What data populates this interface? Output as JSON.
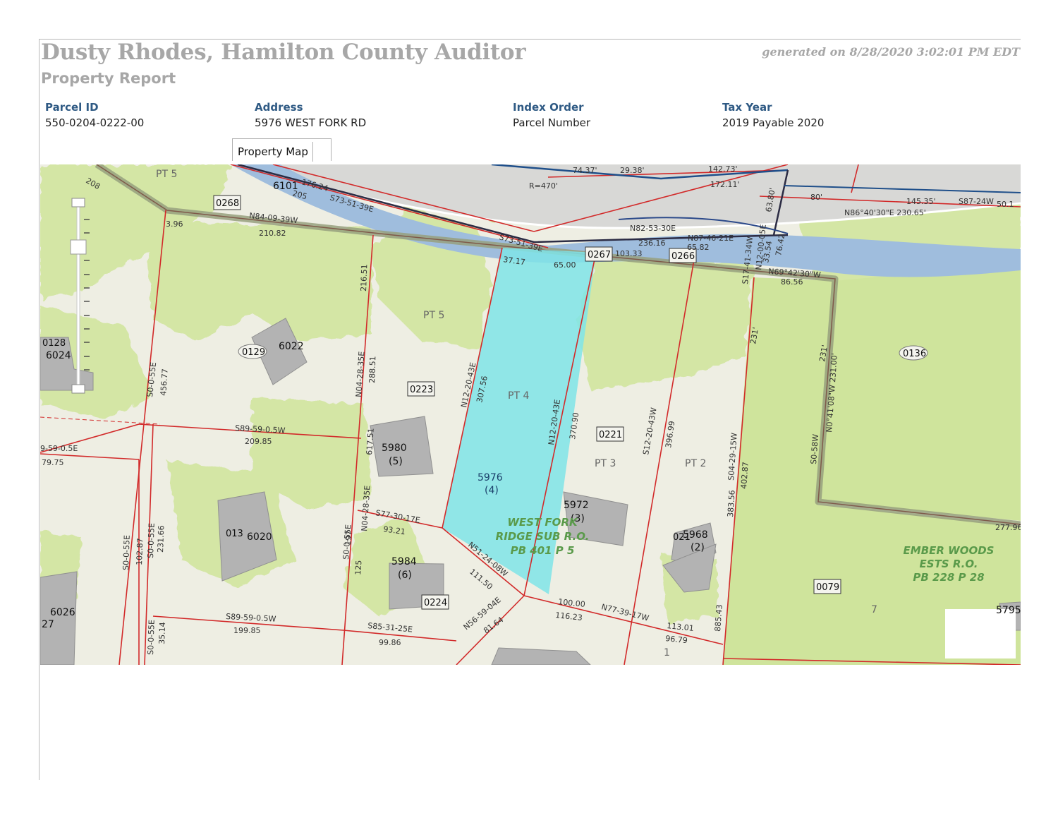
{
  "header": {
    "auditor_title": "Dusty Rhodes, Hamilton County Auditor",
    "report_title": "Property Report",
    "generated": "generated on 8/28/2020 3:02:01 PM EDT"
  },
  "fields": [
    {
      "label": "Parcel ID",
      "value": "550-0204-0222-00"
    },
    {
      "label": "Address",
      "value": "5976 WEST FORK RD"
    },
    {
      "label": "Index Order",
      "value": "Parcel Number"
    },
    {
      "label": "Tax Year",
      "value": "2019 Payable 2020"
    }
  ],
  "tab": {
    "label": "Property Map"
  },
  "map": {
    "parcel_boxes": [
      "0268",
      "0267",
      "0266",
      "0223",
      "0221",
      "0224",
      "0079"
    ],
    "parcel_ovals": [
      "0129",
      "0136",
      "0128",
      "013",
      "021"
    ],
    "house_numbers": [
      "6101",
      "6022",
      "6024",
      "5980",
      "(5)",
      "5976",
      "(4)",
      "5972",
      "(3)",
      "5968",
      "(2)",
      "5984",
      "(6)",
      "6020",
      "6026",
      "27",
      "5795"
    ],
    "lot_labels": [
      "PT 5",
      "PT 5",
      "PT 4",
      "PT 3",
      "PT 2",
      "7",
      "1"
    ],
    "bearings": [
      "N84-09-39W",
      "S73-51-39E",
      "S73-51-39E",
      "N82-53-30E",
      "N87-46-21E",
      "N69°42'30\"W",
      "N86°40'30\"E 230.65'",
      "S87-24W",
      "N12-20-43E",
      "N12-20-43E",
      "N04-28-35E",
      "N04-28-35E",
      "S0-0-55E",
      "S0-0-55E",
      "S0-0-55E",
      "S0-0-55E",
      "S0-0-55E",
      "S89-59-0.5W",
      "S89-59-0.5W",
      "9-59-0.5E",
      "S77-30-17E",
      "N51-24-08W",
      "N56-59-04E",
      "N77-39-17W",
      "S85-31-25E",
      "S12-20-43W",
      "S04-29-15W",
      "S0-58W",
      "N0°41'08\"W 231.00'",
      "S17-41-34W",
      "N12-00-05E"
    ],
    "dimensions": [
      "74.37'",
      "29.38'",
      "142.73'",
      "172.11'",
      "R=470'",
      "80'",
      "145.35'",
      "50.1",
      "63.80'",
      "210.82",
      "208",
      "3.96",
      "205",
      "176.24",
      "236.16",
      "65.82",
      "103.33",
      "37.17",
      "65.00",
      "76.42",
      "33.54",
      "86.56",
      "216.51",
      "288.51",
      "456.77",
      "307.56",
      "370.90",
      "396.99",
      "402.87",
      "383.56",
      "231'",
      "231'",
      "209.85",
      "79.75",
      "617.51",
      "197",
      "93.21",
      "111.50",
      "100.00",
      "116.23",
      "113.01",
      "96.79",
      "81.64",
      "99.86",
      "199.85",
      "231.66",
      "35.14",
      "125",
      "885.43",
      "277.96",
      "102.87"
    ],
    "subdivisions": [
      {
        "lines": [
          "WEST FORK",
          "RIDGE SUB R.O.",
          "PB 401 P 5"
        ]
      },
      {
        "lines": [
          "EMBER WOODS",
          "ESTS R.O.",
          "PB 228 P 28"
        ]
      }
    ],
    "colors": {
      "highlight": "#7fe4e8",
      "vegetation": "#d4e6a5",
      "creek": "#9fbddd",
      "road": "#d8d8d6",
      "parcel_line": "#d22a2a",
      "district": "#96a07e",
      "building": "#b3b3b3"
    }
  }
}
